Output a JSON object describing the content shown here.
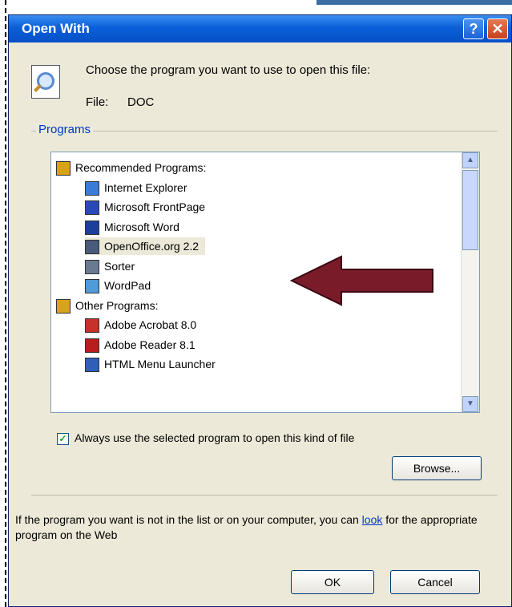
{
  "window": {
    "title": "Open With",
    "help_label": "?",
    "close_label": "✕"
  },
  "header": {
    "instruction": "Choose the program you want to use to open this file:",
    "file_label": "File:",
    "file_name": "DOC"
  },
  "programs": {
    "group_label": "Programs",
    "items": [
      {
        "label": "Recommended Programs:",
        "type": "category",
        "icon": "folder-icon",
        "color": "#d8a21b"
      },
      {
        "label": "Internet Explorer",
        "type": "program",
        "icon": "internet-explorer-icon",
        "color": "#3b7bd8"
      },
      {
        "label": "Microsoft FrontPage",
        "type": "program",
        "icon": "frontpage-icon",
        "color": "#2a49b8"
      },
      {
        "label": "Microsoft Word",
        "type": "program",
        "icon": "word-icon",
        "color": "#1c3f9e"
      },
      {
        "label": "OpenOffice.org 2.2",
        "type": "program",
        "icon": "openoffice-icon",
        "color": "#4a5a7a"
      },
      {
        "label": "Sorter",
        "type": "program",
        "icon": "sorter-icon",
        "color": "#6a7a90"
      },
      {
        "label": "WordPad",
        "type": "program",
        "icon": "wordpad-icon",
        "color": "#4f9ad8"
      },
      {
        "label": "Other Programs:",
        "type": "category",
        "icon": "folder-icon",
        "color": "#d8a21b"
      },
      {
        "label": "Adobe Acrobat 8.0",
        "type": "program",
        "icon": "acrobat-icon",
        "color": "#c8302a"
      },
      {
        "label": "Adobe Reader 8.1",
        "type": "program",
        "icon": "adobe-reader-icon",
        "color": "#b81e1e"
      },
      {
        "label": "HTML Menu Launcher",
        "type": "program",
        "icon": "html-launcher-icon",
        "color": "#2f5fb8"
      }
    ],
    "selected_item": "OpenOffice.org 2.2",
    "scroll_up": "▲",
    "scroll_down": "▼"
  },
  "always_use": {
    "label": "Always use the selected program to open this kind of file",
    "checked": true,
    "check_mark": "✓"
  },
  "browse_label": "Browse...",
  "web_help": {
    "text": "If the program you want is not in the list or on your computer, you can",
    "link_label": "look",
    "text_after": "for the appropriate program on the Web"
  },
  "buttons": {
    "ok": "OK",
    "cancel": "Cancel"
  },
  "annotation": {
    "arrow_color": "#7a1b2a"
  }
}
